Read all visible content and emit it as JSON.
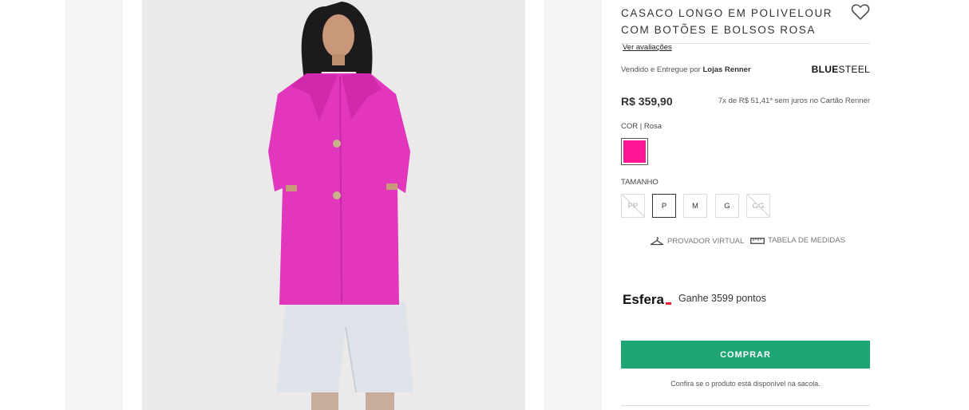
{
  "product": {
    "title": "CASACO LONGO EM POLIVELOUR COM BOTÕES E BOLSOS ROSA",
    "reviews_link": "Ver avaliações",
    "seller_prefix": "Vendido e Entregue por",
    "seller_name": "Lojas Renner",
    "brand_bold": "BLUE",
    "brand_light": "STEEL",
    "price": "R$ 359,90",
    "installments": "7x de R$ 51,41* sem juros no Cartão Renner"
  },
  "color": {
    "label": "COR",
    "value": "Rosa",
    "swatch_hex": "#ff1493"
  },
  "size": {
    "label": "TAMANHO",
    "options": [
      {
        "label": "PP",
        "available": false,
        "selected": false
      },
      {
        "label": "P",
        "available": true,
        "selected": true
      },
      {
        "label": "M",
        "available": true,
        "selected": false
      },
      {
        "label": "G",
        "available": true,
        "selected": false
      },
      {
        "label": "GG",
        "available": false,
        "selected": false
      }
    ]
  },
  "tools": {
    "virtual_fitting": "PROVADOR VIRTUAL",
    "size_chart": "TABELA DE MEDIDAS",
    "virtual_fitting_icon": "hanger-icon",
    "size_chart_icon": "ruler-icon"
  },
  "loyalty": {
    "logo_text": "Esfera",
    "points_text": "Ganhe 3599 pontos"
  },
  "actions": {
    "buy_label": "COMPRAR",
    "buy_note": "Confira se o produto está disponível na sacola.",
    "accent_color": "#1ea674"
  },
  "icons": {
    "favorite": "heart-icon"
  }
}
